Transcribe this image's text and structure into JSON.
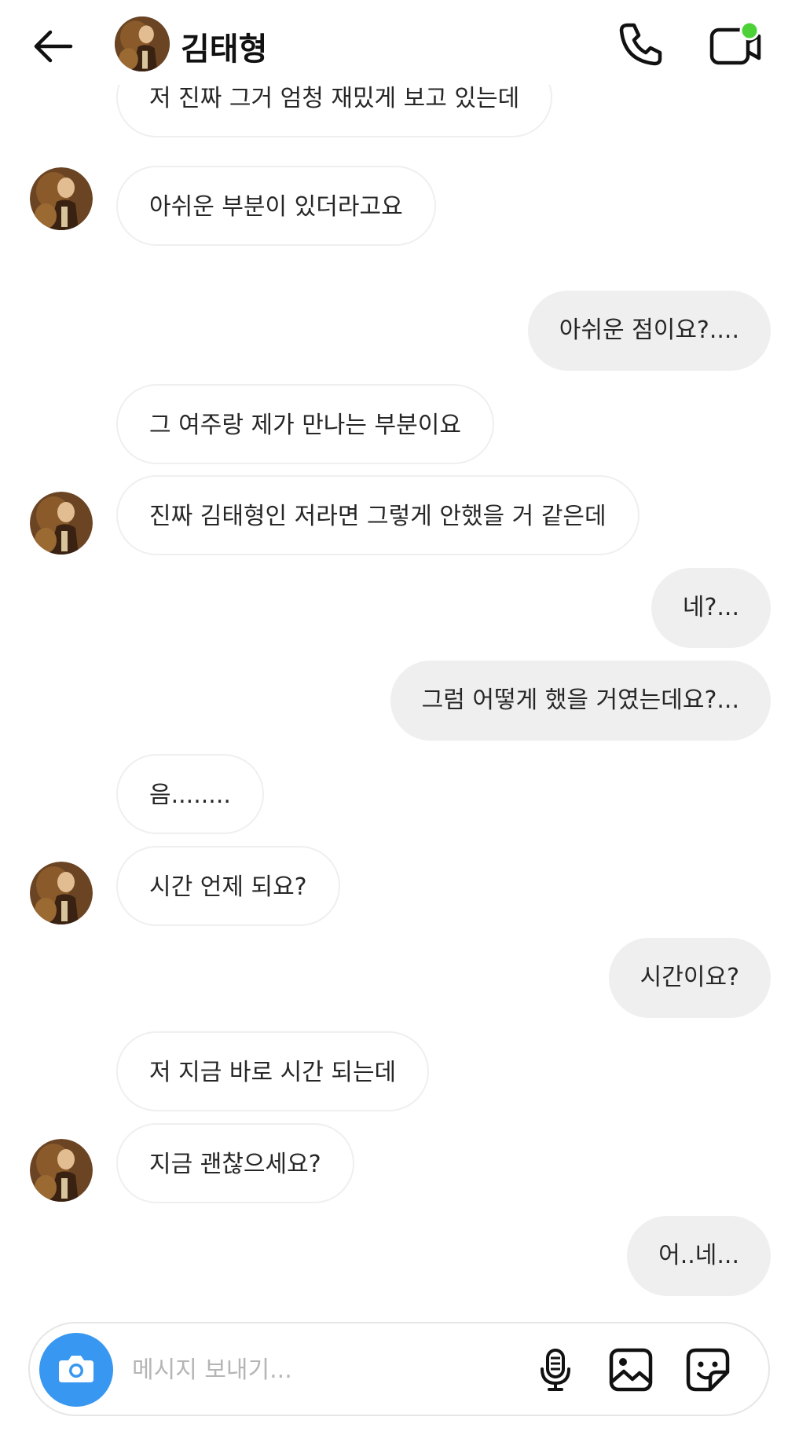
{
  "header": {
    "contact_name": "김태형",
    "online_dot_color": "#4cd137"
  },
  "messages": [
    {
      "side": "in",
      "text": "저 진짜 그거 엄청 재밌게 보고 있는데",
      "avatar": false
    },
    {
      "side": "in",
      "text": "아쉬운 부분이 있더라고요",
      "avatar": true
    },
    {
      "side": "out",
      "text": "아쉬운 점이요?....",
      "avatar": false
    },
    {
      "side": "in",
      "text": "그 여주랑 제가 만나는 부분이요",
      "avatar": false
    },
    {
      "side": "in",
      "text": "진짜 김태형인 저라면 그렇게 안했을 거 같은데",
      "avatar": true
    },
    {
      "side": "out",
      "text": "네?...",
      "avatar": false
    },
    {
      "side": "out",
      "text": "그럼 어떻게 했을 거였는데요?...",
      "avatar": false
    },
    {
      "side": "in",
      "text": "음........",
      "avatar": false
    },
    {
      "side": "in",
      "text": "시간 언제 되요?",
      "avatar": true
    },
    {
      "side": "out",
      "text": "시간이요?",
      "avatar": false
    },
    {
      "side": "in",
      "text": "저 지금 바로 시간 되는데",
      "avatar": false
    },
    {
      "side": "in",
      "text": "지금 괜찮으세요?",
      "avatar": true
    },
    {
      "side": "out",
      "text": "어..네...",
      "avatar": false
    }
  ],
  "composer": {
    "placeholder": "메시지 보내기...",
    "value": "",
    "camera_color": "#3897f0"
  },
  "icons": {
    "back": "back-arrow-icon",
    "call": "phone-icon",
    "video": "video-call-icon",
    "camera": "camera-icon",
    "mic": "microphone-icon",
    "gallery": "gallery-icon",
    "sticker": "sticker-icon"
  }
}
